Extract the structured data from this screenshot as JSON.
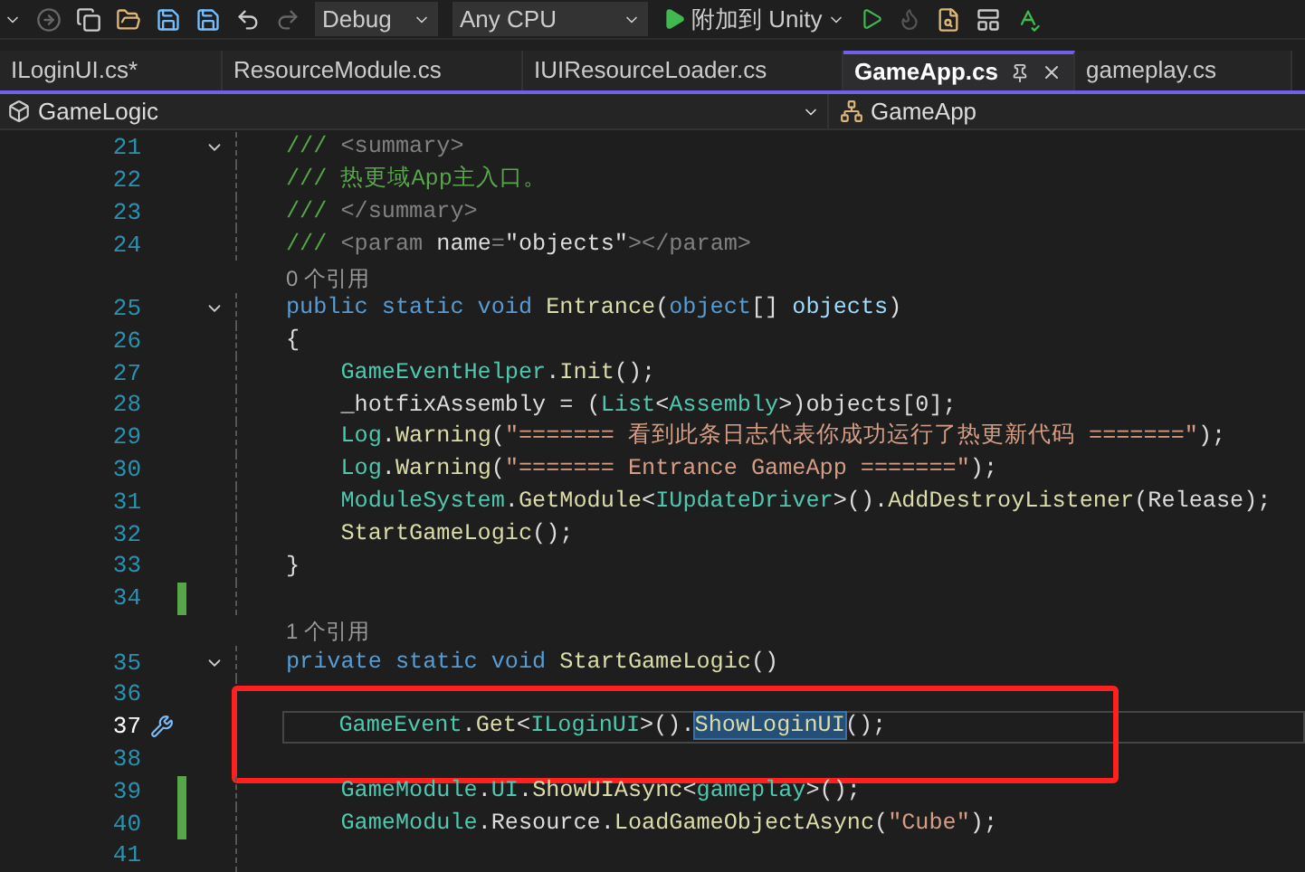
{
  "toolbar": {
    "configuration": "Debug",
    "platform": "Any CPU",
    "run_target": "附加到 Unity"
  },
  "tabs": [
    {
      "label": "ILoginUI.cs*",
      "selected": false
    },
    {
      "label": "ResourceModule.cs",
      "selected": false
    },
    {
      "label": "IUIResourceLoader.cs",
      "selected": false
    },
    {
      "label": "GameApp.cs",
      "selected": true
    },
    {
      "label": "gameplay.cs",
      "selected": false
    }
  ],
  "nav_bar": {
    "project": "GameLogic",
    "class": "GameApp"
  },
  "lines": [
    {
      "kind": "code",
      "number": "21",
      "fold": true,
      "modified": false,
      "current": false,
      "boxed": false,
      "tokens": [
        {
          "kind": "doc",
          "text": "/// "
        },
        {
          "kind": "doctag",
          "text": "<summary>"
        }
      ]
    },
    {
      "kind": "code",
      "number": "22",
      "fold": false,
      "modified": false,
      "current": false,
      "boxed": false,
      "tokens": [
        {
          "kind": "doc",
          "text": "/// 热更域App主入口。"
        }
      ]
    },
    {
      "kind": "code",
      "number": "23",
      "fold": false,
      "modified": false,
      "current": false,
      "boxed": false,
      "tokens": [
        {
          "kind": "doc",
          "text": "/// "
        },
        {
          "kind": "doctag",
          "text": "</summary>"
        }
      ]
    },
    {
      "kind": "code",
      "number": "24",
      "fold": false,
      "modified": false,
      "current": false,
      "boxed": false,
      "tokens": [
        {
          "kind": "doc",
          "text": "/// "
        },
        {
          "kind": "doctag",
          "text": "<param "
        },
        {
          "kind": "plain",
          "text": "name"
        },
        {
          "kind": "doctag",
          "text": "="
        },
        {
          "kind": "plain",
          "text": "\"objects\""
        },
        {
          "kind": "doctag",
          "text": "></param>"
        }
      ]
    },
    {
      "kind": "codelens",
      "text": "0 个引用"
    },
    {
      "kind": "code",
      "number": "25",
      "fold": true,
      "modified": false,
      "current": false,
      "boxed": false,
      "tokens": [
        {
          "kind": "keyword",
          "text": "public static void "
        },
        {
          "kind": "method",
          "text": "Entrance"
        },
        {
          "kind": "plain",
          "text": "("
        },
        {
          "kind": "keyword",
          "text": "object"
        },
        {
          "kind": "plain",
          "text": "[] "
        },
        {
          "kind": "param",
          "text": "objects"
        },
        {
          "kind": "plain",
          "text": ")"
        }
      ]
    },
    {
      "kind": "code",
      "number": "26",
      "fold": false,
      "modified": false,
      "current": false,
      "boxed": false,
      "tokens": [
        {
          "kind": "plain",
          "text": "{"
        }
      ]
    },
    {
      "kind": "code",
      "number": "27",
      "fold": false,
      "modified": false,
      "current": false,
      "boxed": false,
      "tokens": [
        {
          "kind": "type",
          "text": "    GameEventHelper"
        },
        {
          "kind": "plain",
          "text": "."
        },
        {
          "kind": "method",
          "text": "Init"
        },
        {
          "kind": "plain",
          "text": "();"
        }
      ]
    },
    {
      "kind": "code",
      "number": "28",
      "fold": false,
      "modified": false,
      "current": false,
      "boxed": false,
      "tokens": [
        {
          "kind": "plain",
          "text": "    _hotfixAssembly = ("
        },
        {
          "kind": "type",
          "text": "List"
        },
        {
          "kind": "plain",
          "text": "<"
        },
        {
          "kind": "type",
          "text": "Assembly"
        },
        {
          "kind": "plain",
          "text": ">)objects[0];"
        }
      ]
    },
    {
      "kind": "code",
      "number": "29",
      "fold": false,
      "modified": false,
      "current": false,
      "boxed": false,
      "tokens": [
        {
          "kind": "type",
          "text": "    Log"
        },
        {
          "kind": "plain",
          "text": "."
        },
        {
          "kind": "method",
          "text": "Warning"
        },
        {
          "kind": "plain",
          "text": "("
        },
        {
          "kind": "string",
          "text": "\"======= 看到此条日志代表你成功运行了热更新代码 =======\""
        },
        {
          "kind": "plain",
          "text": ");"
        }
      ]
    },
    {
      "kind": "code",
      "number": "30",
      "fold": false,
      "modified": false,
      "current": false,
      "boxed": false,
      "tokens": [
        {
          "kind": "type",
          "text": "    Log"
        },
        {
          "kind": "plain",
          "text": "."
        },
        {
          "kind": "method",
          "text": "Warning"
        },
        {
          "kind": "plain",
          "text": "("
        },
        {
          "kind": "string",
          "text": "\"======= Entrance GameApp =======\""
        },
        {
          "kind": "plain",
          "text": ");"
        }
      ]
    },
    {
      "kind": "code",
      "number": "31",
      "fold": false,
      "modified": false,
      "current": false,
      "boxed": false,
      "tokens": [
        {
          "kind": "type",
          "text": "    ModuleSystem"
        },
        {
          "kind": "plain",
          "text": "."
        },
        {
          "kind": "method",
          "text": "GetModule"
        },
        {
          "kind": "plain",
          "text": "<"
        },
        {
          "kind": "type",
          "text": "IUpdateDriver"
        },
        {
          "kind": "plain",
          "text": ">()."
        },
        {
          "kind": "method",
          "text": "AddDestroyListener"
        },
        {
          "kind": "plain",
          "text": "(Release);"
        }
      ]
    },
    {
      "kind": "code",
      "number": "32",
      "fold": false,
      "modified": false,
      "current": false,
      "boxed": false,
      "tokens": [
        {
          "kind": "method",
          "text": "    StartGameLogic"
        },
        {
          "kind": "plain",
          "text": "();"
        }
      ]
    },
    {
      "kind": "code",
      "number": "33",
      "fold": false,
      "modified": false,
      "current": false,
      "boxed": false,
      "tokens": [
        {
          "kind": "plain",
          "text": "}"
        }
      ]
    },
    {
      "kind": "code",
      "number": "34",
      "fold": false,
      "modified": true,
      "current": false,
      "boxed": false
    },
    {
      "kind": "codelens",
      "text": "1 个引用"
    },
    {
      "kind": "code",
      "number": "35",
      "fold": true,
      "modified": false,
      "current": false,
      "boxed": false,
      "tokens": [
        {
          "kind": "keyword",
          "text": "private static void "
        },
        {
          "kind": "method",
          "text": "StartGameLogic"
        },
        {
          "kind": "plain",
          "text": "()"
        }
      ]
    },
    {
      "kind": "code",
      "number": "36",
      "fold": false,
      "modified": false,
      "current": false,
      "boxed": true
    },
    {
      "kind": "code",
      "number": "37",
      "fold": false,
      "modified": false,
      "current": true,
      "boxed": true,
      "tokens": [
        {
          "kind": "type",
          "text": "    GameEvent"
        },
        {
          "kind": "plain",
          "text": "."
        },
        {
          "kind": "method",
          "text": "Get"
        },
        {
          "kind": "plain",
          "text": "<"
        },
        {
          "kind": "type",
          "text": "ILoginUI"
        },
        {
          "kind": "plain",
          "text": ">()."
        },
        {
          "kind": "method",
          "text": "ShowLoginUI",
          "selected": true
        },
        {
          "kind": "plain",
          "text": "();"
        }
      ]
    },
    {
      "kind": "code",
      "number": "38",
      "fold": false,
      "modified": false,
      "current": false,
      "boxed": true
    },
    {
      "kind": "code",
      "number": "39",
      "fold": false,
      "modified": true,
      "current": false,
      "boxed": false,
      "tokens": [
        {
          "kind": "type",
          "text": "    GameModule"
        },
        {
          "kind": "plain",
          "text": "."
        },
        {
          "kind": "type",
          "text": "UI"
        },
        {
          "kind": "plain",
          "text": "."
        },
        {
          "kind": "method",
          "text": "ShowUIAsync"
        },
        {
          "kind": "plain",
          "text": "<"
        },
        {
          "kind": "type",
          "text": "gameplay"
        },
        {
          "kind": "plain",
          "text": ">();"
        }
      ]
    },
    {
      "kind": "code",
      "number": "40",
      "fold": false,
      "modified": true,
      "current": false,
      "boxed": false,
      "tokens": [
        {
          "kind": "type",
          "text": "    GameModule"
        },
        {
          "kind": "plain",
          "text": "."
        },
        {
          "kind": "plain",
          "text": "Resource"
        },
        {
          "kind": "plain",
          "text": "."
        },
        {
          "kind": "method",
          "text": "LoadGameObjectAsync"
        },
        {
          "kind": "plain",
          "text": "("
        },
        {
          "kind": "string",
          "text": "\"Cube\""
        },
        {
          "kind": "plain",
          "text": ");"
        }
      ]
    },
    {
      "kind": "code",
      "number": "41",
      "fold": false,
      "modified": false,
      "current": false,
      "boxed": false
    }
  ]
}
